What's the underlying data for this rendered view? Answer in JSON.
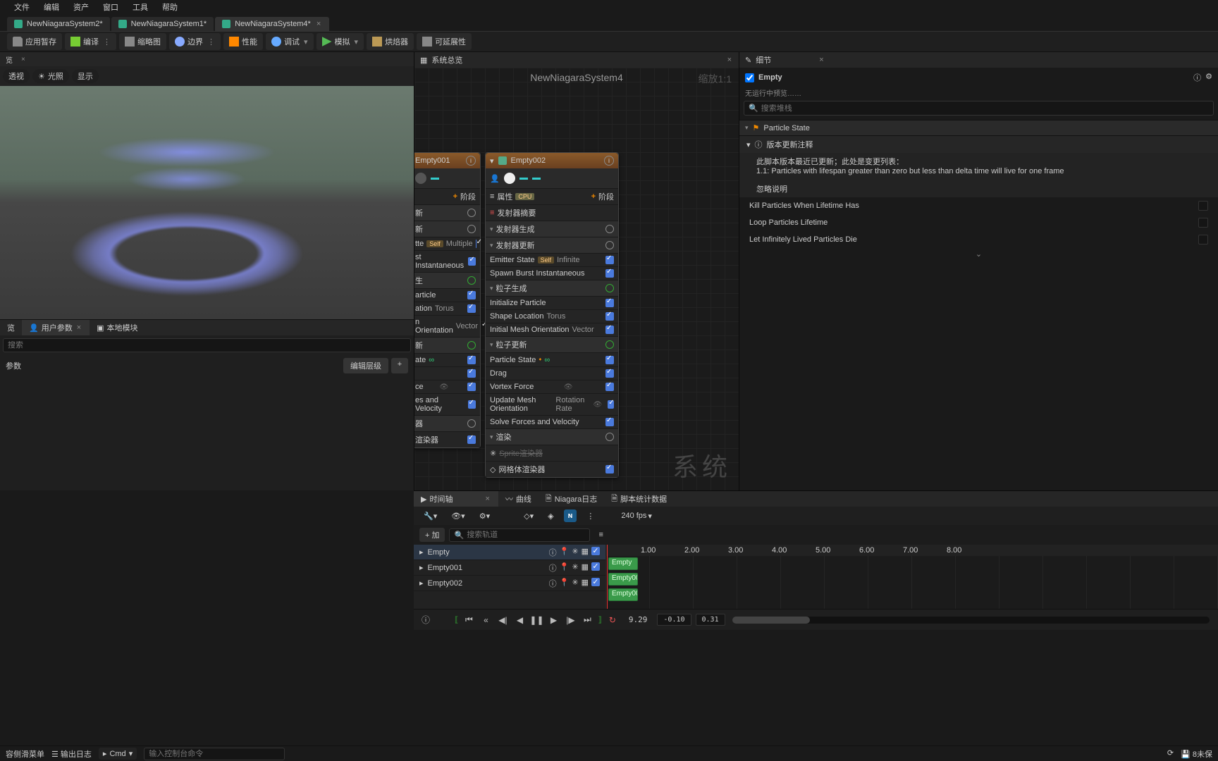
{
  "menu": [
    "文件",
    "编辑",
    "资产",
    "窗口",
    "工具",
    "帮助"
  ],
  "file_tabs": [
    {
      "label": "NewNiagaraSystem2*",
      "active": false
    },
    {
      "label": "NewNiagaraSystem1*",
      "active": false
    },
    {
      "label": "NewNiagaraSystem4*",
      "active": true
    }
  ],
  "toolbar": {
    "save": "应用暂存",
    "compile": "编译",
    "thumb": "缩略图",
    "bounds": "边界",
    "perf": "性能",
    "debug": "调试",
    "sim": "模拟",
    "bake": "烘焙器",
    "scale": "可延展性"
  },
  "viewport": {
    "tab": "览",
    "perspective": "透视",
    "lit": "光照",
    "show": "显示"
  },
  "user_params": {
    "tab_preview": "览",
    "tab_user": "用户参数",
    "tab_local": "本地模块",
    "search_ph": "搜索",
    "group": "参数",
    "edit_layers": "编辑层级"
  },
  "system_overview": {
    "tab": "系统总览",
    "title": "NewNiagaraSystem4",
    "zoom": "缩放1:1",
    "watermark": "系统"
  },
  "emitter_partial": {
    "name": "Empty001",
    "stage": "阶段",
    "section1": "新",
    "section2": "新",
    "es": "tte",
    "es_self": "Self",
    "es_mult": "Multiple",
    "spawn": "st Instantaneous",
    "section3": "生",
    "init": "article",
    "shape": "ation",
    "shape_v": "Torus",
    "orient": "n Orientation",
    "orient_v": "Vector",
    "section4": "新",
    "ps": "ate",
    "vf": "ce",
    "upd": "es and Velocity",
    "section5": "器",
    "spr": "渲染器"
  },
  "emitter_full": {
    "name": "Empty002",
    "props": "属性",
    "cpu": "CPU",
    "stage": "阶段",
    "summary": "发射器摘要",
    "spawn_sec": "发射器生成",
    "update_sec": "发射器更新",
    "es": "Emitter State",
    "es_self": "Self",
    "es_inf": "Infinite",
    "burst": "Spawn Burst Instantaneous",
    "pspawn": "粒子生成",
    "init": "Initialize Particle",
    "shape": "Shape Location",
    "shape_v": "Torus",
    "orient": "Initial Mesh Orientation",
    "orient_v": "Vector",
    "pupdate": "粒子更新",
    "pstate": "Particle State",
    "drag": "Drag",
    "vortex": "Vortex Force",
    "umo": "Update Mesh Orientation",
    "umo_v": "Rotation Rate",
    "solve": "Solve Forces and Velocity",
    "render": "渲染",
    "sprite": "Sprite渲染器",
    "mesh": "网格体渲染器"
  },
  "details": {
    "tab": "细节",
    "selected": "Empty",
    "preview_msg": "无运行中预览……",
    "search_ph": "搜索堆栈",
    "cat": "Particle State",
    "note_h": "版本更新注释",
    "note1": "此脚本版本最近已更新；此处是变更列表：",
    "note2": "1.1: Particles with lifespan greater than zero but less than delta time will live for one frame",
    "note3": "忽略说明",
    "r1": "Kill Particles When Lifetime Has",
    "r2": "Loop Particles Lifetime",
    "r3": "Let Infinitely Lived Particles Die"
  },
  "timeline": {
    "tab_tl": "时间轴",
    "tab_curve": "曲线",
    "tab_log": "Niagara日志",
    "tab_stats": "脚本统计数据",
    "fps": "240 fps",
    "add": "+ 加",
    "search_ph": "搜索轨道",
    "tracks": [
      "Empty",
      "Empty001",
      "Empty002"
    ],
    "ruler": [
      "1.00",
      "2.00",
      "3.00",
      "4.00",
      "5.00",
      "6.00",
      "7.00",
      "8.00"
    ],
    "playtime": "9.29",
    "range_lo": "-0.10",
    "range_hi": "0.31"
  },
  "status": {
    "drawer": "容侧滑菜单",
    "output": "输出日志",
    "cmd": "Cmd",
    "input_ph": "输入控制台命令",
    "unsaved": "8未保"
  }
}
